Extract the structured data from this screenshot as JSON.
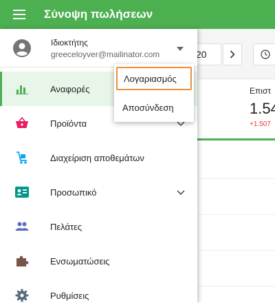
{
  "appbar": {
    "title": "Σύνοψη πωλήσεων"
  },
  "account": {
    "role": "Ιδιοκτήτης",
    "email": "greeceloyver@mailinator.com"
  },
  "popup": {
    "items": [
      {
        "label": "Λογαριασμός"
      },
      {
        "label": "Αποσύνδεση"
      }
    ]
  },
  "nav": {
    "items": [
      {
        "label": "Αναφορές",
        "icon": "bar-chart-icon"
      },
      {
        "label": "Προϊόντα",
        "icon": "basket-icon"
      },
      {
        "label": "Διαχείριση αποθεμάτων",
        "icon": "inventory-cart-icon"
      },
      {
        "label": "Προσωπικό",
        "icon": "employee-badge-icon"
      },
      {
        "label": "Πελάτες",
        "icon": "customers-icon"
      },
      {
        "label": "Ενσωματώσεις",
        "icon": "puzzle-icon"
      },
      {
        "label": "Ρυθμίσεις",
        "icon": "gear-icon"
      }
    ]
  },
  "background": {
    "date_text": "20",
    "card_label": "Επιστ",
    "card_value": "1.54",
    "card_delta": "+1.507"
  },
  "colors": {
    "accent": "#4caf50",
    "highlight": "#f08c3a",
    "negative": "#e53935"
  }
}
